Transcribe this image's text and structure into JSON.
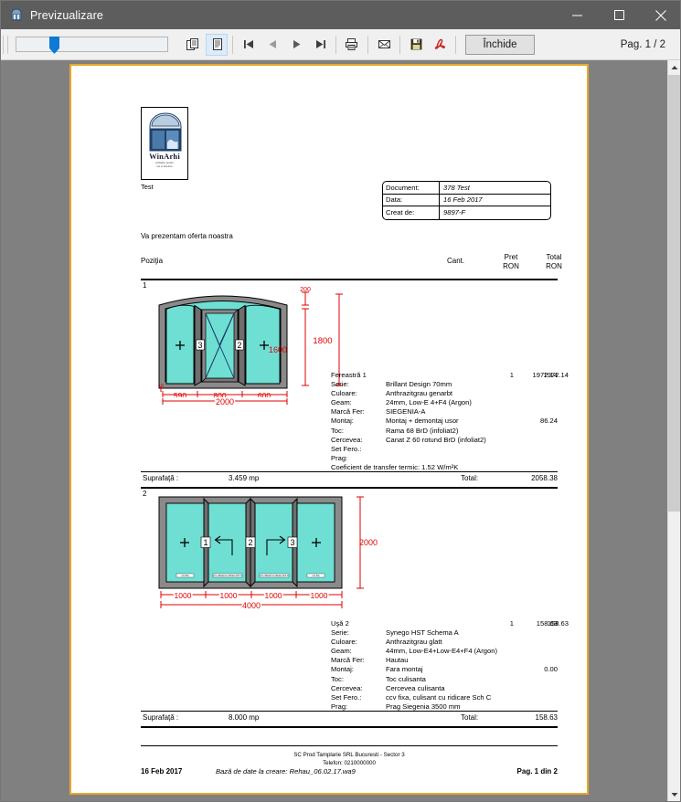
{
  "window": {
    "title": "Previzualizare",
    "icon": "preview-window-icon",
    "minimize_label": "–",
    "maximize_label": "☐",
    "close_label": "✕"
  },
  "toolbar": {
    "zoom_slider_name": "zoom-slider",
    "zoom_thumb_position_pct": 22,
    "buttons": [
      {
        "name": "multi-page-view-button",
        "icon": "multipage-icon",
        "active": false
      },
      {
        "name": "single-page-view-button",
        "icon": "singlepage-icon",
        "active": true
      },
      {
        "name": "first-page-button",
        "icon": "first-page-icon",
        "active": false
      },
      {
        "name": "previous-page-button",
        "icon": "previous-page-icon",
        "active": false
      },
      {
        "name": "next-page-button",
        "icon": "next-page-icon",
        "active": false
      },
      {
        "name": "last-page-button",
        "icon": "last-page-icon",
        "active": false
      },
      {
        "name": "print-button",
        "icon": "printer-icon",
        "active": false
      },
      {
        "name": "email-button",
        "icon": "envelope-icon",
        "active": false
      },
      {
        "name": "save-button",
        "icon": "floppy-disk-icon",
        "active": false
      },
      {
        "name": "export-pdf-button",
        "icon": "pdf-icon",
        "active": false
      }
    ],
    "close_label": "Închide",
    "page_indicator": "Pag. 1 / 2"
  },
  "document": {
    "logo": {
      "brand": "WinArhi",
      "tagline": "software pentru\nusi si ferestre",
      "caption": "Test"
    },
    "info_table": [
      {
        "key": "Document:",
        "value": "378 Test"
      },
      {
        "key": "Data:",
        "value": "16 Feb 2017"
      },
      {
        "key": "Creat de:",
        "value": "9897-F"
      }
    ],
    "intro": "Va prezentam oferta noastra",
    "columns": {
      "position": "Poziţia",
      "quantity": "Cant.",
      "price_l1": "Pret",
      "price_l2": "RON",
      "total_l1": "Total",
      "total_l2": "RON"
    },
    "items": [
      {
        "number": "1",
        "name": "Fereastră 1",
        "qty": "1",
        "price": "1972.14",
        "total": "1972.14",
        "specs": [
          {
            "label": "Serie:",
            "value": "Brillant Design 70mm"
          },
          {
            "label": "Culoare:",
            "value": "Anthrazitgrau genarbt"
          },
          {
            "label": "Geam:",
            "value": "24mm, Low-E 4+F4 (Argon)"
          },
          {
            "label": "Marcă Fer:",
            "value": "SIEGENIA-A"
          },
          {
            "label": "Montaj:",
            "value": "Montaj + demontaj usor",
            "amount": "86.24"
          },
          {
            "label": "Toc:",
            "value": "Rama 68 BrD (infoliat2)"
          },
          {
            "label": "Cercevea:",
            "value": "Canat Z 60 rotund BrD (infoliat2)"
          },
          {
            "label": "Set Fero.:",
            "value": ""
          },
          {
            "label": "Prag:",
            "value": ""
          }
        ],
        "thermal": "Coeficient de transfer termic: 1.52 W/m²K",
        "area_label": "Suprafaţă :",
        "area_value": "3.459 mp",
        "total_label": "Total:",
        "total_value": "2058.38",
        "drawing": {
          "type": "arched-window",
          "widths": [
            "590",
            "800",
            "600"
          ],
          "total_width": "2000",
          "heights": {
            "side": "1600",
            "arch": "200",
            "overall": "1800"
          },
          "small_dim": "10",
          "sash_labels": [
            "3",
            "2"
          ]
        }
      },
      {
        "number": "2",
        "name": "Uşă 2",
        "qty": "1",
        "price": "158.63",
        "total": "158.63",
        "specs": [
          {
            "label": "Serie:",
            "value": "Synego HST  Schema A"
          },
          {
            "label": "Culoare:",
            "value": "Anthrazitgrau glatt"
          },
          {
            "label": "Geam:",
            "value": "44mm, Low-E4+Low-E4+F4 (Argon)"
          },
          {
            "label": "Marcă Fer:",
            "value": "Hautau"
          },
          {
            "label": "Montaj:",
            "value": "Fara montaj",
            "amount": "0.00"
          },
          {
            "label": "Toc:",
            "value": "Toc culisanta"
          },
          {
            "label": "Cercevea:",
            "value": "Cercevea culisanta"
          },
          {
            "label": "Set Fero.:",
            "value": "ccv fixa, culisant cu ridicare Sch C"
          },
          {
            "label": "Prag:",
            "value": "Prag Siegenia 3500 mm"
          }
        ],
        "thermal": "",
        "area_label": "Suprafaţă :",
        "area_value": "8.000 mp",
        "total_label": "Total:",
        "total_value": "158.63",
        "drawing": {
          "type": "sliding-door",
          "widths": [
            "1000",
            "1000",
            "1000",
            "1000"
          ],
          "total_width": "4000",
          "heights": {
            "overall": "2000"
          },
          "sash_labels": [
            "1",
            "2",
            "3"
          ]
        }
      }
    ],
    "footer": {
      "company": "SC Prod Tamplarie SRL Bucuresti - Sector 3",
      "phone": "Telefon: 0210000000",
      "date": "16 Feb 2017",
      "database": "Bază de date la creare: Rehau_06.02.17.wa9",
      "page": "Pag. 1 din 2"
    }
  },
  "colors": {
    "titlebar": "#5d5d5d",
    "toolbar": "#f0f0f0",
    "canvas_bg": "#808080",
    "page_border": "#e9a72c",
    "glass": "#6fdfd4",
    "dimension": "#e00000",
    "slider_thumb": "#0d7ad4"
  }
}
